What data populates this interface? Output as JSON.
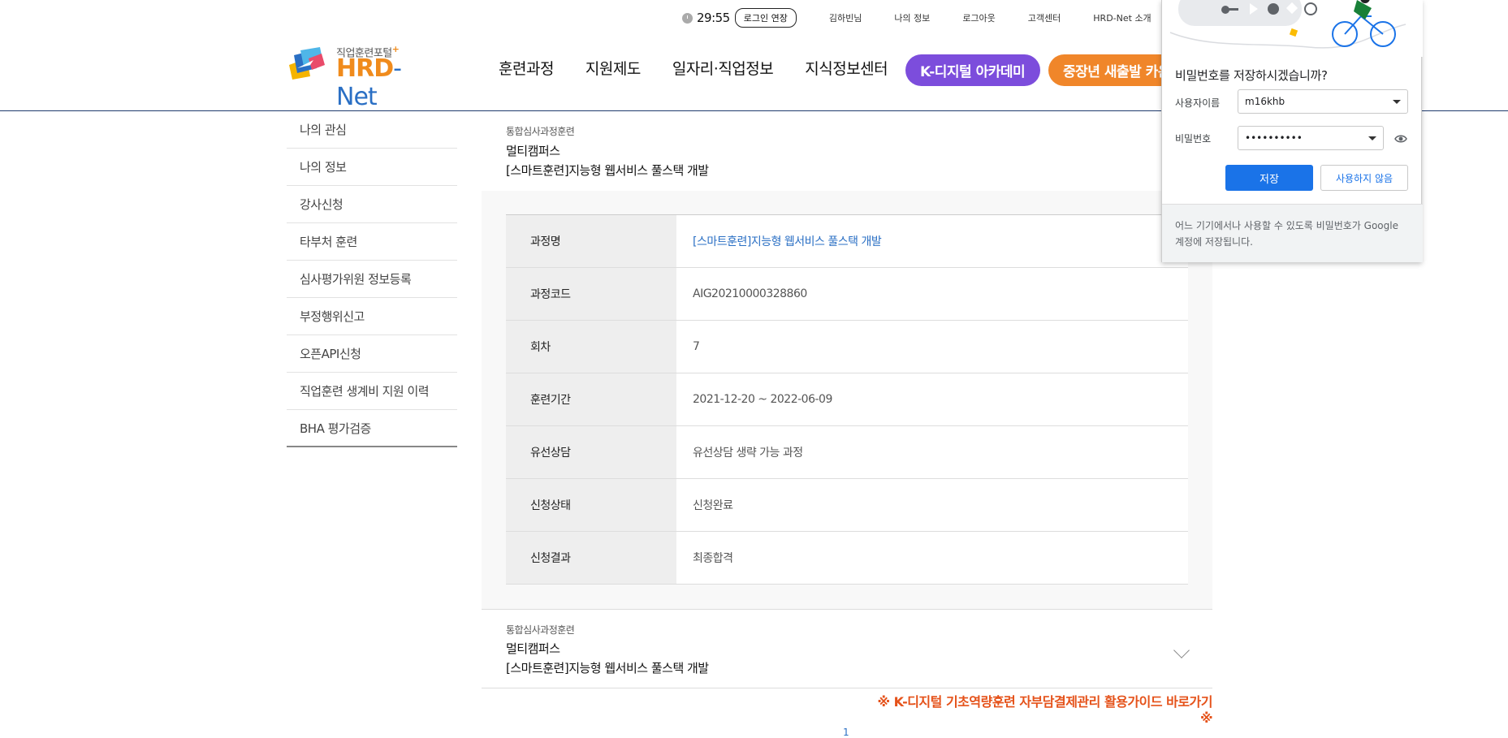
{
  "util": {
    "timer": "29:55",
    "extend_label": "로그인 연장",
    "user_name": "김하빈님",
    "my_info": "나의 정보",
    "logout": "로그아웃",
    "customer_center": "고객센터",
    "about": "HRD-Net 소개"
  },
  "logo": {
    "tagline": "직업훈련포털",
    "tag_plus": "+",
    "brand_main": "HRD",
    "brand_sub": "- Net"
  },
  "nav": {
    "items": [
      "훈련과정",
      "지원제도",
      "일자리·직업정보",
      "지식정보센터"
    ],
    "pill_digital": "K-디지털 아카데미",
    "pill_midcareer": "중장년 새출발 카운슬링"
  },
  "sidebar": {
    "items": [
      "나의 관심",
      "나의 정보",
      "강사신청",
      "타부처 훈련",
      "심사평가위원 정보등록",
      "부정행위신고",
      "오픈API신청",
      "직업훈련 생계비 지원 이력",
      "BHA 평가검증"
    ]
  },
  "course1": {
    "category": "통합심사과정훈련",
    "org": "멀티캠퍼스",
    "title": "[스마트훈련]지능형 웹서비스 풀스택 개발"
  },
  "details": [
    {
      "key": "과정명",
      "value": "[스마트훈련]지능형 웹서비스 풀스택 개발"
    },
    {
      "key": "과정코드",
      "value": "AIG20210000328860"
    },
    {
      "key": "회차",
      "value": "7"
    },
    {
      "key": "훈련기간",
      "value": "2021-12-20 ~ 2022-06-09"
    },
    {
      "key": "유선상담",
      "value": "유선상담 생략 가능 과정"
    },
    {
      "key": "신청상태",
      "value": "신청완료"
    },
    {
      "key": "신청결과",
      "value": "최종합격"
    }
  ],
  "course2": {
    "category": "통합심사과정훈련",
    "org": "멀티캠퍼스",
    "title": "[스마트훈련]지능형 웹서비스 풀스택 개발"
  },
  "guide_link": "※ K-디지털 기초역량훈련 자부담결제관리 활용가이드 바로가기※",
  "pagination": {
    "current": "1"
  },
  "password_popup": {
    "question": "비밀번호를 저장하시겠습니까?",
    "username_label": "사용자이름",
    "username_value": "m16khb",
    "password_label": "비밀번호",
    "password_value": "••••••••••",
    "save_label": "저장",
    "never_label": "사용하지 않음",
    "footer": "어느 기기에서나 사용할 수 있도록 비밀번호가 Google 계정에 저장됩니다."
  },
  "colors": {
    "nav_line": "#1e3a6d",
    "brand_orange": "#f08b1c",
    "brand_blue": "#2a6fc4",
    "pill_purple": "#7c4ddc",
    "pill_orange": "#f0862a",
    "guide_red": "#e5521a",
    "chrome_blue": "#1a73e8"
  }
}
